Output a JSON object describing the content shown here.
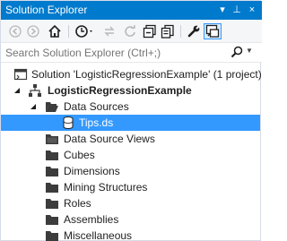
{
  "window": {
    "title": "Solution Explorer",
    "title_buttons": [
      "▾",
      "⊥",
      "×"
    ]
  },
  "search": {
    "placeholder": "Search Solution Explorer (Ctrl+;)"
  },
  "tree": {
    "solution": "Solution 'LogisticRegressionExample' (1 project)",
    "project": "LogisticRegressionExample",
    "data_sources": "Data Sources",
    "tips": "Tips.ds",
    "data_source_views": "Data Source Views",
    "cubes": "Cubes",
    "dimensions": "Dimensions",
    "mining_structures": "Mining Structures",
    "roles": "Roles",
    "assemblies": "Assemblies",
    "miscellaneous": "Miscellaneous"
  },
  "colors": {
    "accent": "#007acc",
    "selection": "#3399ff",
    "folder": "#3c3c3c"
  }
}
